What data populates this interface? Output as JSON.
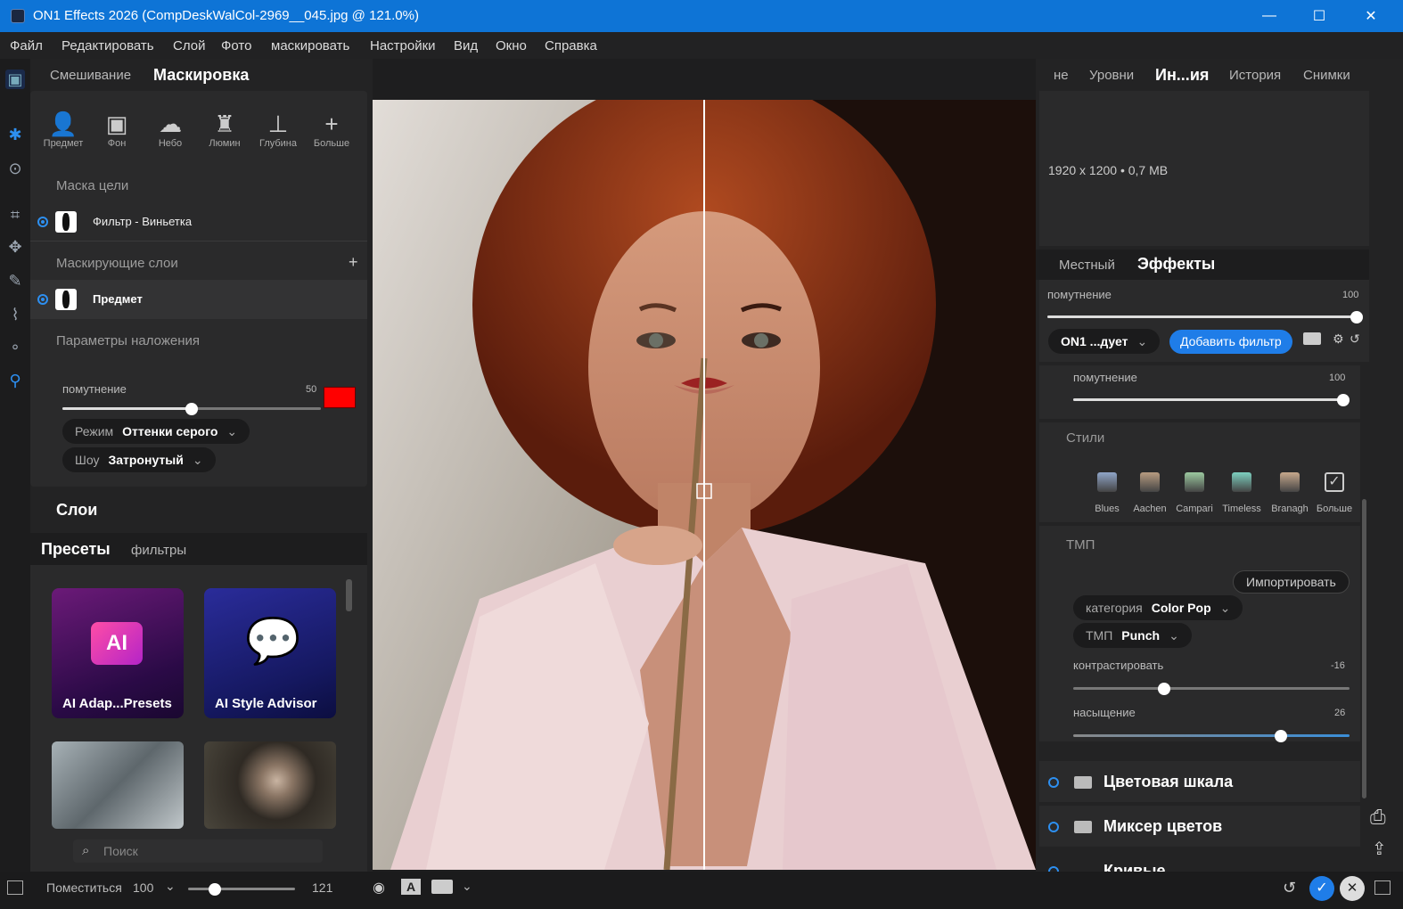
{
  "window": {
    "title": "ON1 Effects 2026 (CompDeskWalCol-2969__045.jpg @ 121.0%)",
    "min": "—",
    "max": "☐",
    "close": "✕"
  },
  "menu": [
    "Файл",
    "Редактировать",
    "Слой",
    "Фото",
    "маскировать",
    "Настройки",
    "Вид",
    "Окно",
    "Справка"
  ],
  "left": {
    "tabs": [
      "Смешивание",
      "Маскировка"
    ],
    "mask_tools": [
      "Предмет",
      "Фон",
      "Небо",
      "Люмин",
      "Глубина",
      "Больше"
    ],
    "target_mask_header": "Маска цели",
    "target_mask_item": "Фильтр - Виньетка",
    "masking_layers_header": "Маскирующие слои",
    "plus": "+",
    "mask_layer_item": "Предмет",
    "overlay_header": "Параметры наложения",
    "opacity_label": "помутнение",
    "opacity_value": "50",
    "opacity_fraction": 0.5,
    "overlay_color": "#ff0000",
    "mode_label": "Режим",
    "mode_value": "Оттенки серого",
    "show_label": "Шоу",
    "show_value": "Затронутый",
    "layers_title": "Слои",
    "preset_tabs": [
      "Пресеты",
      "фильтры"
    ],
    "presets": [
      "AI Adap...Presets",
      "AI Style Advisor",
      "AI"
    ],
    "search_placeholder": "Поиск"
  },
  "right": {
    "tabs": [
      "не",
      "Уровни",
      "Ин...ия",
      "История",
      "Снимки"
    ],
    "image_info": "1920 x 1200 • 0,7 MB",
    "sub_tabs": [
      "Местный",
      "Эффекты"
    ],
    "opacity_label": "помутнение",
    "opacity_value": "100",
    "opacity_fraction": 1.0,
    "filter_select": "ON1 ...дует",
    "add_filter": "Добавить фильтр",
    "filter_opacity_label": "помутнение",
    "filter_opacity_value": "100",
    "filter_opacity_fraction": 1.0,
    "styles_header": "Стили",
    "styles": [
      {
        "name": "Blues",
        "color": "#8fa5c8"
      },
      {
        "name": "Aachen",
        "color": "#b79b80"
      },
      {
        "name": "Campari",
        "color": "#9cc9a0"
      },
      {
        "name": "Timeless",
        "color": "#7dd0c0"
      },
      {
        "name": "Branagh",
        "color": "#c7a88c"
      },
      {
        "name": "Больше",
        "color": "none"
      }
    ],
    "tmp_header": "ТМП",
    "import_button": "Импортировать",
    "category_label": "категория",
    "category_value": "Color Pop",
    "tmp_label": "ТМП",
    "tmp_value": "Punch",
    "contrast_label": "контрастировать",
    "contrast_value": "-16",
    "contrast_fraction": 0.33,
    "saturation_label": "насыщение",
    "saturation_value": "26",
    "saturation_fraction": 0.75,
    "sections": [
      "Цветовая шкала",
      "Миксер цветов",
      "Кривые"
    ]
  },
  "bottom": {
    "fit": "Поместиться",
    "zoom": "100",
    "zoom_max": "121",
    "zoom_fraction": 0.25
  }
}
